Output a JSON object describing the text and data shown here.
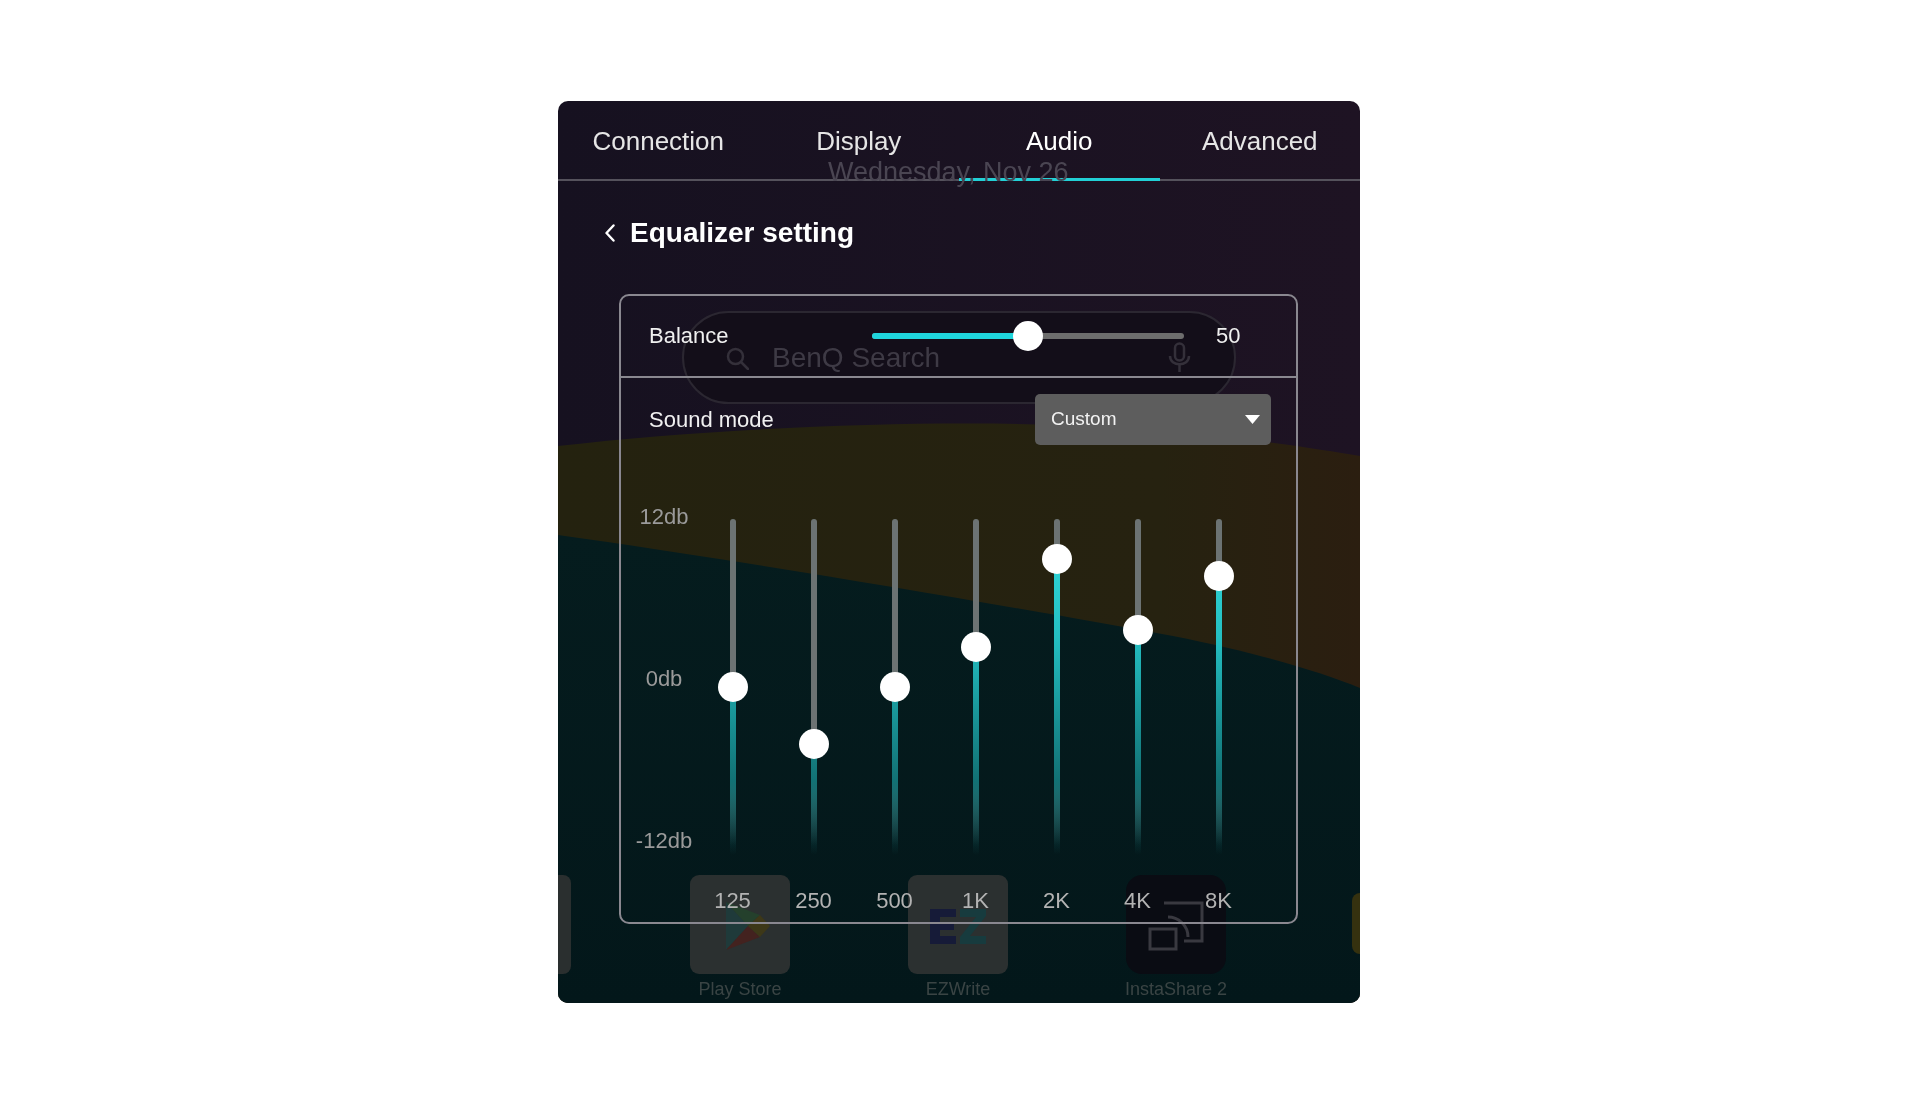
{
  "home_screen": {
    "date": "Wednesday, Nov 26",
    "search": {
      "placeholder": "BenQ Search"
    },
    "apps": [
      {
        "label": "Play Store"
      },
      {
        "label": "EZWrite"
      },
      {
        "label": "InstaShare 2"
      }
    ]
  },
  "tabs": [
    {
      "label": "Connection",
      "selected": false
    },
    {
      "label": "Display",
      "selected": false
    },
    {
      "label": "Audio",
      "selected": true
    },
    {
      "label": "Advanced",
      "selected": false
    }
  ],
  "page": {
    "title": "Equalizer setting"
  },
  "balance": {
    "label": "Balance",
    "level": 0.5,
    "reading": "50"
  },
  "sound_mode": {
    "label": "Sound mode",
    "value": "Custom"
  },
  "equalizer": {
    "scale_labels": [
      "12db",
      "0db",
      "-12db"
    ],
    "bands": [
      {
        "label": "125",
        "level": 0.5
      },
      {
        "label": "250",
        "level": 0.33
      },
      {
        "label": "500",
        "level": 0.5
      },
      {
        "label": "1K",
        "level": 0.62
      },
      {
        "label": "2K",
        "level": 0.88
      },
      {
        "label": "4K",
        "level": 0.67
      },
      {
        "label": "8K",
        "level": 0.83
      }
    ]
  }
}
